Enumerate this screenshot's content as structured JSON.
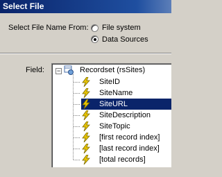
{
  "window": {
    "title": "Select File"
  },
  "select_from": {
    "label": "Select File Name From:",
    "options": [
      {
        "label": "File system",
        "selected": false
      },
      {
        "label": "Data Sources",
        "selected": true
      }
    ]
  },
  "field": {
    "label": "Field:",
    "tree": {
      "root": {
        "label": "Recordset (rsSites)",
        "expanded": true,
        "icon": "recordset-icon"
      },
      "items": [
        {
          "label": "SiteID",
          "icon": "bolt-icon",
          "selected": false
        },
        {
          "label": "SiteName",
          "icon": "bolt-icon",
          "selected": false
        },
        {
          "label": "SiteURL",
          "icon": "bolt-icon",
          "selected": true
        },
        {
          "label": "SiteDescription",
          "icon": "bolt-icon",
          "selected": false
        },
        {
          "label": "SiteTopic",
          "icon": "bolt-icon",
          "selected": false
        },
        {
          "label": "[first record index]",
          "icon": "bolt-icon",
          "selected": false
        },
        {
          "label": "[last record index]",
          "icon": "bolt-icon",
          "selected": false
        },
        {
          "label": "[total records]",
          "icon": "bolt-icon",
          "selected": false
        }
      ]
    }
  },
  "colors": {
    "title_bar": "#0a246a",
    "dialog_bg": "#d4d0c8",
    "selection": "#0a246a",
    "bolt": "#e8c400"
  }
}
